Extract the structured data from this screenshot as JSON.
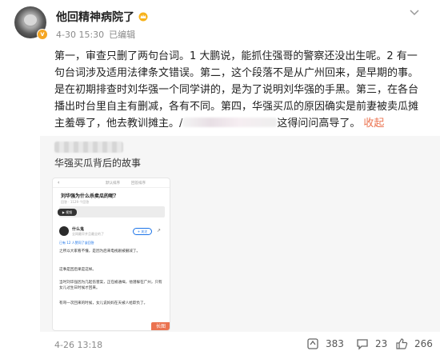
{
  "post": {
    "username": "他回精神病院了",
    "timestamp": "4-30 15:30",
    "source": "已编辑",
    "more_icon": "chevron-down-icon",
    "content_before_blur": "第一，审查只删了两句台词。1 大鹏说，能抓住强哥的警察还没出生呢。2 有一句台词涉及适用法律条文错误。第二，这个段落不是从广州回来，是早期的事。是在初期排查时刘华强一个同学讲的，是为了说明刘华强的手黑。第三，在各台播出时台里自主有删减，各有不同。第四，华强买瓜的原因确实是前妻被卖瓜摊主羞辱了，他去教训摊主。/",
    "content_after_blur": "这得问问高导了。",
    "collapse_label": "收起"
  },
  "repost": {
    "text": "华强买瓜背后的故事",
    "thumbnail": {
      "question": "刘华强为什么杀卖瓜的呢？",
      "question_meta": "回答 · 1129 个回答",
      "top_tabs": [
        "默认排序",
        "回答排序"
      ],
      "video_tag": "▶ 视频",
      "user_name": "什么鬼",
      "user_desc": "全网最早并且最全的了",
      "follow_label": "+ 关注",
      "likes_text": "已有 12 人赞同了该回答",
      "paragraphs": [
        "之所以大家看不懂，是因为后来电视剧被删减了。",
        "这事是回后果是这样。",
        "当时刘华强因为几起伤害案，正在被通缉，他潜躲在广州，只有女儿过生日时候才回来。",
        "有哥一次回来的时候，女儿说妈妈在天被人给欺负了。"
      ],
      "longpic_label": "长图"
    }
  },
  "footer": {
    "time": "4-26 13:18",
    "repost_count": "383",
    "comment_count": "23",
    "like_count": "266"
  }
}
